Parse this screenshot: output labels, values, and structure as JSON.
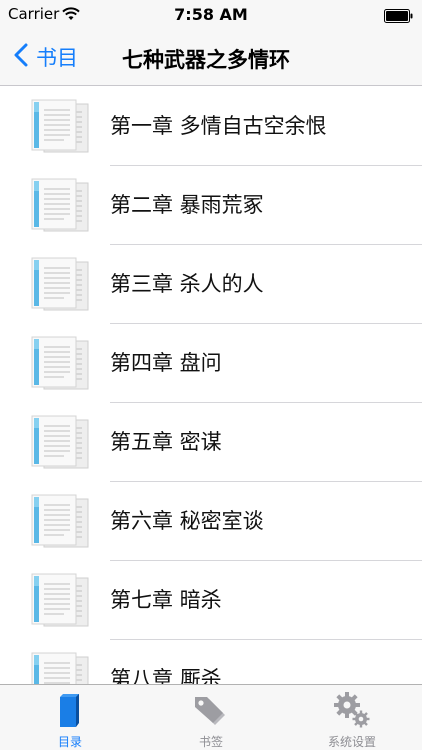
{
  "status_bar": {
    "carrier": "Carrier",
    "time": "7:58 AM"
  },
  "nav": {
    "back_label": "书目",
    "title": "七种武器之多情环"
  },
  "chapters": [
    {
      "title": "第一章 多情自古空余恨"
    },
    {
      "title": "第二章 暴雨荒冢"
    },
    {
      "title": "第三章 杀人的人"
    },
    {
      "title": "第四章 盘问"
    },
    {
      "title": "第五章 密谋"
    },
    {
      "title": "第六章 秘密室谈"
    },
    {
      "title": "第七章 暗杀"
    },
    {
      "title": "第八章 厮杀"
    }
  ],
  "tabs": [
    {
      "label": "目录",
      "icon": "book-icon",
      "active": true
    },
    {
      "label": "书签",
      "icon": "tag-icon",
      "active": false
    },
    {
      "label": "系统设置",
      "icon": "gears-icon",
      "active": false
    }
  ],
  "colors": {
    "accent": "#157efb",
    "inactive": "#8e8e93",
    "bar_background": "#f7f7f7"
  }
}
